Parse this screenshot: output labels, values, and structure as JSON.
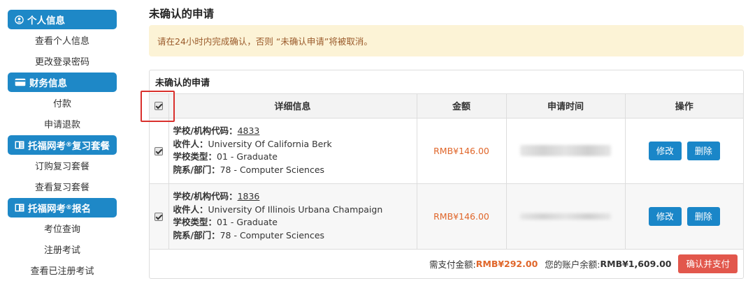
{
  "sidebar": {
    "sections": [
      {
        "title": "个人信息",
        "icon": "user-circle-icon",
        "items": [
          "查看个人信息",
          "更改登录密码"
        ]
      },
      {
        "title": "财务信息",
        "icon": "credit-card-icon",
        "items": [
          "付款",
          "申请退款"
        ]
      },
      {
        "title_prefix": "托福网考",
        "title_sup": "®",
        "title_suffix": "复习套餐",
        "icon": "book-icon",
        "items": [
          "订购复习套餐",
          "查看复习套餐"
        ]
      },
      {
        "title_prefix": "托福网考",
        "title_sup": "®",
        "title_suffix": "报名",
        "icon": "book-icon",
        "items": [
          "考位查询",
          "注册考试",
          "查看已注册考试"
        ]
      }
    ]
  },
  "main": {
    "title": "未确认的申请",
    "alert": "请在24小时内完成确认，否则 “未确认申请”将被取消。",
    "panel_title": "未确认的申请",
    "columns": [
      "详细信息",
      "金额",
      "申请时间",
      "操作"
    ],
    "labels": {
      "code": "学校/机构代码：",
      "recipient": "收件人：",
      "school_type": "学校类型：",
      "department": "院系/部门："
    },
    "rows": [
      {
        "code": "4833",
        "recipient": "University Of California Berk",
        "school_type": "01 - Graduate",
        "department": "78 - Computer Sciences",
        "amount": "RMB¥146.00",
        "edit": "修改",
        "delete": "删除"
      },
      {
        "code": "1836",
        "recipient": "University Of Illinois Urbana Champaign",
        "school_type": "01 - Graduate",
        "department": "78 - Computer Sciences",
        "amount": "RMB¥146.00",
        "edit": "修改",
        "delete": "删除"
      }
    ],
    "footer": {
      "due_label": "需支付金额:",
      "due_value": "RMB¥292.00",
      "balance_label": "您的账户余额:",
      "balance_value": "RMB¥1,609.00",
      "pay_button": "确认并支付"
    }
  },
  "colors": {
    "accent": "#1e88c7",
    "amount": "#e0662a",
    "pay_button": "#e2574c",
    "alert_bg": "#fcf3d6",
    "highlight": "#d9302c"
  }
}
